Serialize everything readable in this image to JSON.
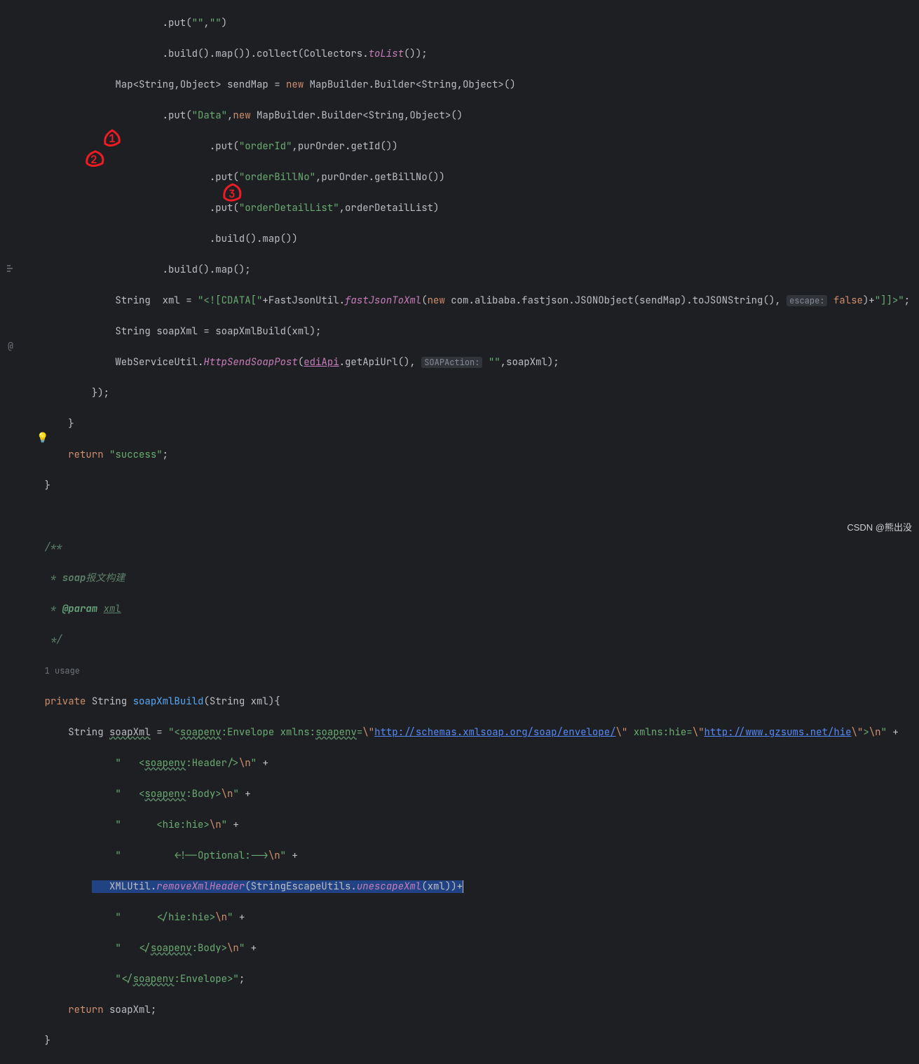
{
  "code": {
    "l1_a": ".put(",
    "l1_b": "\"\"",
    "l1_c": ",",
    "l1_d": "\"\"",
    "l1_e": ")",
    "l2_a": ".build().map()).collect(Collectors.",
    "l2_b": "toList",
    "l2_c": "());",
    "l3_a": "Map<String,Object> sendMap = ",
    "l3_b": "new ",
    "l3_c": "MapBuilder.Builder<String,Object>()",
    "l4_a": ".put(",
    "l4_b": "\"Data\"",
    "l4_c": ",",
    "l4_d": "new ",
    "l4_e": "MapBuilder.Builder<String,Object>()",
    "l5_a": ".put(",
    "l5_b": "\"orderId\"",
    "l5_c": ",purOrder.getId())",
    "l6_a": ".put(",
    "l6_b": "\"orderBillNo\"",
    "l6_c": ",purOrder.getBillNo())",
    "l7_a": ".put(",
    "l7_b": "\"orderDetailList\"",
    "l7_c": ",orderDetailList)",
    "l8_a": ".build().map())",
    "l9_a": ".build().map();",
    "l10_a": "String  xml = ",
    "l10_b": "\"<![CDATA[\"",
    "l10_c": "+FastJsonUtil.",
    "l10_d": "fastJsonToXml",
    "l10_e": "(",
    "l10_f": "new ",
    "l10_g": "com.alibaba.fastjson.JSONObject(sendMap).toJSONString(), ",
    "l10_h": "escape:",
    "l10_i": " ",
    "l10_j": "false",
    "l10_k": ")+",
    "l10_l": "\"]]>\"",
    "l10_m": ";",
    "l11_a": "String soapXml = soapXmlBuild(xml);",
    "l12_a": "WebServiceUtil.",
    "l12_b": "HttpSendSoapPost",
    "l12_c": "(",
    "l12_d": "ediApi",
    "l12_e": ".getApiUrl(), ",
    "l12_f": "SOAPAction:",
    "l12_g": " ",
    "l12_h": "\"\"",
    "l12_i": ",soapXml);",
    "l13_a": "});",
    "l14_a": "}",
    "l15_a": "return ",
    "l15_b": "\"success\"",
    "l15_c": ";",
    "l16_a": "}",
    "doc1": "/**",
    "doc2_a": " * ",
    "doc2_b": "soap",
    "doc2_c": "报文构建",
    "doc3_a": " * ",
    "doc3_b": "@param",
    "doc3_c": " ",
    "doc3_d": "xml",
    "doc4": " */",
    "usage": "1 usage",
    "m1_a": "private ",
    "m1_b": "String ",
    "m1_c": "soapXmlBuild",
    "m1_d": "(String xml){",
    "m2_a": "String ",
    "m2_b": "soapXml",
    "m2_c": " = ",
    "m2_d": "\"<",
    "m2_e": "soapenv",
    "m2_f": ":Envelope xmlns:",
    "m2_g": "soapenv",
    "m2_h": "=",
    "m2_i": "\\\"",
    "m2_j": "http://schemas.xmlsoap.org/soap/envelope/",
    "m2_k": "\\\"",
    "m2_l": " xmlns:hie=",
    "m2_m": "\\\"",
    "m2_n": "http://www.gzsums.net/hie",
    "m2_o": "\\\"",
    "m2_p": ">",
    "m2_q": "\\n",
    "m2_r": "\"",
    "m2_s": " +",
    "m3_a": "\"   <",
    "m3_b": "soapenv",
    "m3_c": ":Header/>",
    "m3_d": "\\n",
    "m3_e": "\"",
    "m3_f": " +",
    "m4_a": "\"   <",
    "m4_b": "soapenv",
    "m4_c": ":Body>",
    "m4_d": "\\n",
    "m4_e": "\"",
    "m4_f": " +",
    "m5_a": "\"      <hie:hie>",
    "m5_b": "\\n",
    "m5_c": "\"",
    "m5_d": " +",
    "m6_a": "\"         <!--Optional:-->",
    "m6_b": "\\n",
    "m6_c": "\"",
    "m6_d": " +",
    "m7_a": "   XMLUtil.",
    "m7_b": "removeXmlHeader",
    "m7_c": "(StringEscapeUtils.",
    "m7_d": "unescapeXml",
    "m7_e": "(xml))+",
    "m8_a": "\"      </hie:hie>",
    "m8_b": "\\n",
    "m8_c": "\"",
    "m8_d": " +",
    "m9_a": "\"   </",
    "m9_b": "soapenv",
    "m9_c": ":Body>",
    "m9_d": "\\n",
    "m9_e": "\"",
    "m9_f": " +",
    "m10_a": "\"</",
    "m10_b": "soapenv",
    "m10_c": ":Envelope>\"",
    "m10_d": ";",
    "m11_a": "return ",
    "m11_b": "soapXml;",
    "m12_a": "}"
  },
  "indent": {
    "i4": "    ",
    "i8": "        ",
    "i12": "            ",
    "i16": "                ",
    "i20": "                    ",
    "i24": "                        ",
    "i28": "                            ",
    "i32": "                                "
  },
  "watermark": "CSDN @熊出没",
  "annotations": {
    "a1": "1",
    "a2": "2",
    "a3": "3"
  }
}
